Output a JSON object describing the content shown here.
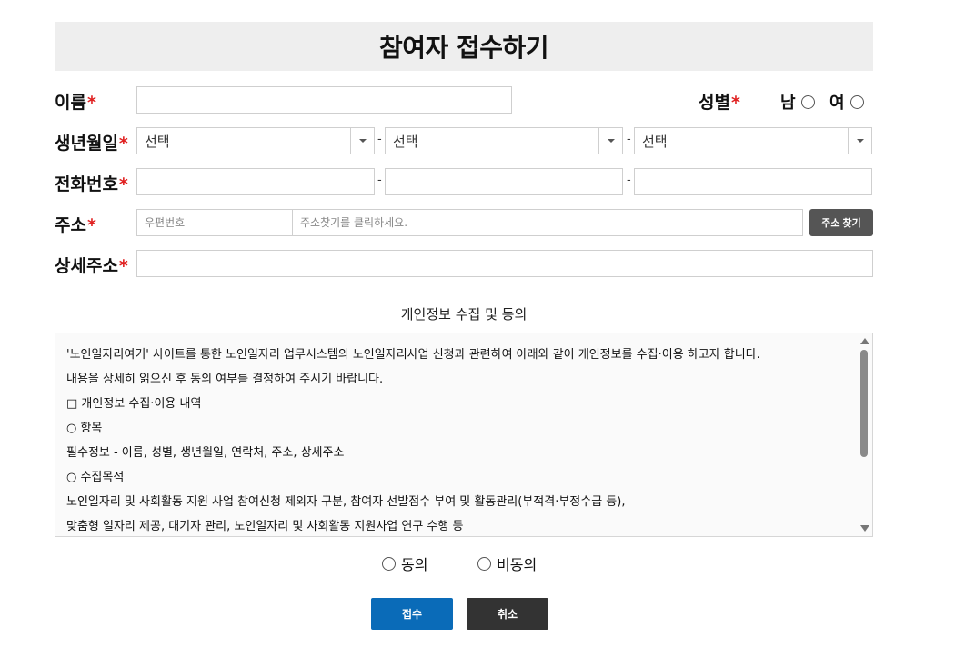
{
  "header": {
    "title": "참여자 접수하기"
  },
  "form": {
    "name": {
      "label": "이름",
      "required_mark": "*",
      "value": ""
    },
    "gender": {
      "label": "성별",
      "required_mark": "*",
      "options": [
        "남",
        "여"
      ]
    },
    "birth": {
      "label": "생년월일",
      "required_mark": "*",
      "year": "선택",
      "month": "선택",
      "day": "선택",
      "separator": "-"
    },
    "phone": {
      "label": "전화번호",
      "required_mark": "*",
      "separator": "-",
      "values": [
        "",
        "",
        ""
      ]
    },
    "address": {
      "label": "주소",
      "required_mark": "*",
      "zip_placeholder": "우편번호",
      "addr_placeholder": "주소찾기를 클릭하세요.",
      "search_button": "주소 찾기"
    },
    "detail_address": {
      "label": "상세주소",
      "required_mark": "*",
      "value": ""
    }
  },
  "consent": {
    "title": "개인정보 수집 및 동의",
    "lines": [
      "'노인일자리여기' 사이트를 통한 노인일자리 업무시스템의 노인일자리사업 신청과 관련하여 아래와 같이 개인정보를 수집·이용 하고자 합니다.",
      "내용을 상세히 읽으신 후 동의 여부를 결정하여 주시기 바랍니다.",
      "□ 개인정보 수집·이용 내역",
      "○ 항목",
      "필수정보 - 이름, 성별, 생년월일, 연락처, 주소, 상세주소",
      "○ 수집목적",
      "노인일자리 및 사회활동 지원 사업 참여신청 제외자 구분, 참여자 선발점수 부여 및 활동관리(부적격·부정수급 등),",
      "맞춤형 일자리 제공, 대기자 관리, 노인일자리 및 사회활동 지원사업 연구 수행 등"
    ],
    "agree_label": "동의",
    "disagree_label": "비동의"
  },
  "actions": {
    "submit": "접수",
    "cancel": "취소"
  },
  "colors": {
    "submit": "#0a6bb8",
    "cancel": "#333333",
    "required": "#e02020",
    "address_button": "#555555"
  }
}
